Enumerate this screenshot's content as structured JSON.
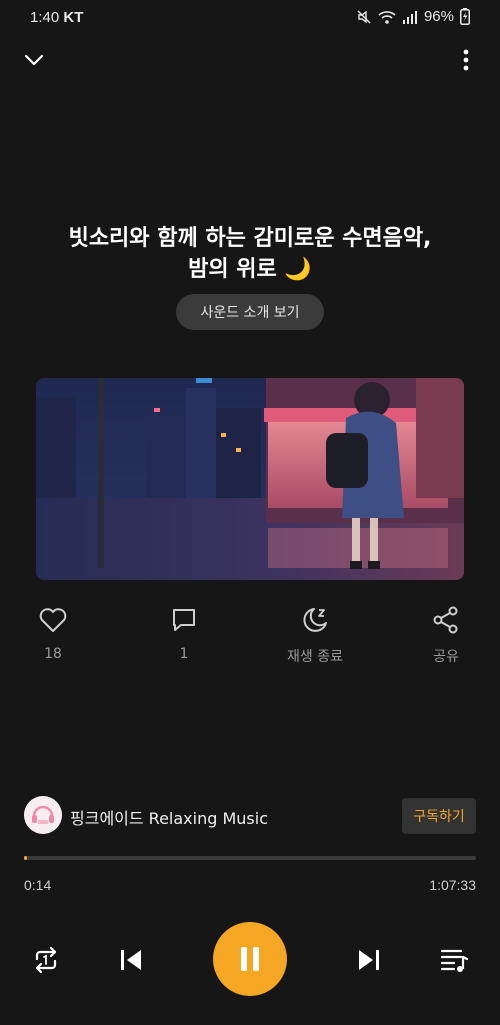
{
  "status_bar": {
    "time": "1:40",
    "carrier": "KT",
    "battery": "96%",
    "icons": [
      "mute-icon",
      "wifi-icon",
      "signal-icon",
      "battery-icon"
    ]
  },
  "header": {
    "collapse_icon": "chevron-down-icon",
    "menu_icon": "more-vertical-icon"
  },
  "track": {
    "title_line1": "빗소리와 함께 하는 감미로운 수면음악,",
    "title_line2": "밤의 위로 🌙",
    "sound_intro_label": "사운드 소개 보기"
  },
  "actions": [
    {
      "icon": "heart-icon",
      "label": "18"
    },
    {
      "icon": "comment-icon",
      "label": "1"
    },
    {
      "icon": "sleep-timer-icon",
      "label": "재생 종료"
    },
    {
      "icon": "share-icon",
      "label": "공유"
    }
  ],
  "channel": {
    "name": "핑크에이드 Relaxing Music",
    "subscribe_label": "구독하기"
  },
  "player": {
    "current_time": "0:14",
    "total_time": "1:07:33",
    "progress": 0.0035,
    "controls": [
      "repeat-icon",
      "previous-icon",
      "pause-icon",
      "next-icon",
      "playlist-icon"
    ]
  },
  "colors": {
    "background": "#161616",
    "accent": "#f5a623",
    "muted_text": "#9a9a9a"
  }
}
